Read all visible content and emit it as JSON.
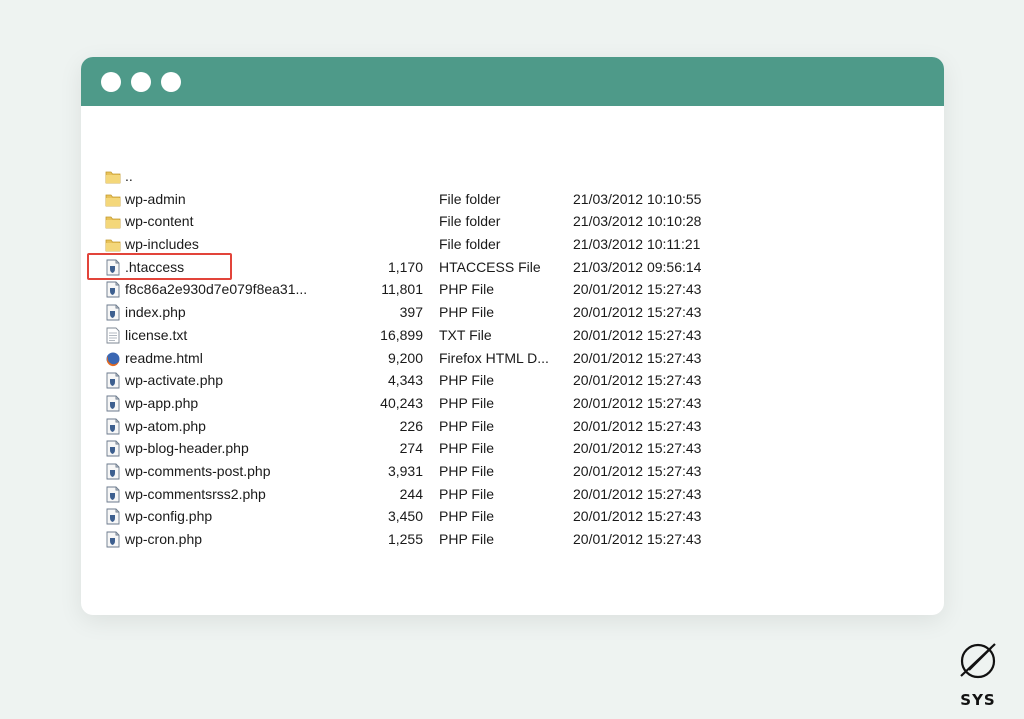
{
  "window": {
    "titlebar_color": "#4e9a89",
    "controls": [
      "window-dot-1",
      "window-dot-2",
      "window-dot-3"
    ]
  },
  "files": [
    {
      "icon": "folder-icon",
      "name": "..",
      "size": "",
      "type": "",
      "modified": ""
    },
    {
      "icon": "folder-icon",
      "name": "wp-admin",
      "size": "",
      "type": "File folder",
      "modified": "21/03/2012 10:10:55"
    },
    {
      "icon": "folder-icon",
      "name": "wp-content",
      "size": "",
      "type": "File folder",
      "modified": "21/03/2012 10:10:28"
    },
    {
      "icon": "folder-icon",
      "name": "wp-includes",
      "size": "",
      "type": "File folder",
      "modified": "21/03/2012 10:11:21"
    },
    {
      "icon": "script-file-icon",
      "name": ".htaccess",
      "size": "1,170",
      "type": "HTACCESS File",
      "modified": "21/03/2012 09:56:14"
    },
    {
      "icon": "script-file-icon",
      "name": "f8c86a2e930d7e079f8ea31...",
      "size": "11,801",
      "type": "PHP File",
      "modified": "20/01/2012 15:27:43"
    },
    {
      "icon": "script-file-icon",
      "name": "index.php",
      "size": "397",
      "type": "PHP File",
      "modified": "20/01/2012 15:27:43"
    },
    {
      "icon": "text-file-icon",
      "name": "license.txt",
      "size": "16,899",
      "type": "TXT File",
      "modified": "20/01/2012 15:27:43"
    },
    {
      "icon": "firefox-icon",
      "name": "readme.html",
      "size": "9,200",
      "type": "Firefox HTML D...",
      "modified": "20/01/2012 15:27:43"
    },
    {
      "icon": "script-file-icon",
      "name": "wp-activate.php",
      "size": "4,343",
      "type": "PHP File",
      "modified": "20/01/2012 15:27:43"
    },
    {
      "icon": "script-file-icon",
      "name": "wp-app.php",
      "size": "40,243",
      "type": "PHP File",
      "modified": "20/01/2012 15:27:43"
    },
    {
      "icon": "script-file-icon",
      "name": "wp-atom.php",
      "size": "226",
      "type": "PHP File",
      "modified": "20/01/2012 15:27:43"
    },
    {
      "icon": "script-file-icon",
      "name": "wp-blog-header.php",
      "size": "274",
      "type": "PHP File",
      "modified": "20/01/2012 15:27:43"
    },
    {
      "icon": "script-file-icon",
      "name": "wp-comments-post.php",
      "size": "3,931",
      "type": "PHP File",
      "modified": "20/01/2012 15:27:43"
    },
    {
      "icon": "script-file-icon",
      "name": "wp-commentsrss2.php",
      "size": "244",
      "type": "PHP File",
      "modified": "20/01/2012 15:27:43"
    },
    {
      "icon": "script-file-icon",
      "name": "wp-config.php",
      "size": "3,450",
      "type": "PHP File",
      "modified": "20/01/2012 15:27:43"
    },
    {
      "icon": "script-file-icon",
      "name": "wp-cron.php",
      "size": "1,255",
      "type": "PHP File",
      "modified": "20/01/2012 15:27:43"
    }
  ],
  "highlight": {
    "target": ".htaccess",
    "color": "#e2443a"
  },
  "brand": {
    "label": "SYS",
    "icon": "sys-logo-icon"
  }
}
